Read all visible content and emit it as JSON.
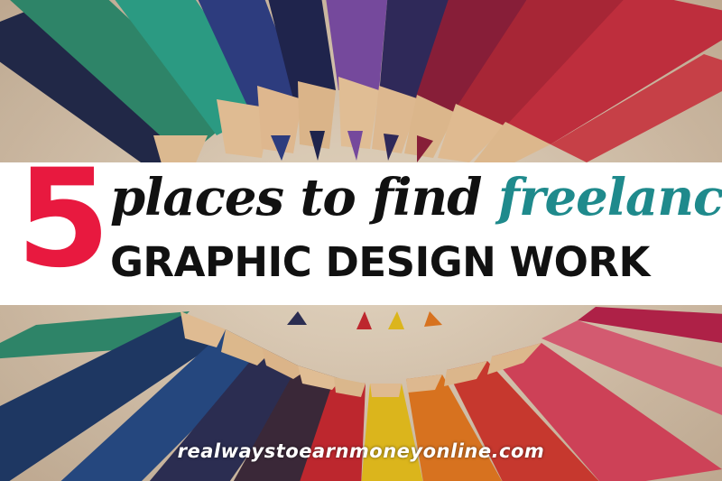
{
  "headline": {
    "number": "5",
    "line1_prefix": "places to find ",
    "line1_accent": "freelance",
    "line2": "GRAPHIC DESIGN WORK"
  },
  "watermark": "realwaystoearnmoneyonline.com",
  "colors": {
    "number": "#e8193f",
    "accent": "#1f8a8c",
    "text": "#111111",
    "banner": "#ffffff"
  }
}
